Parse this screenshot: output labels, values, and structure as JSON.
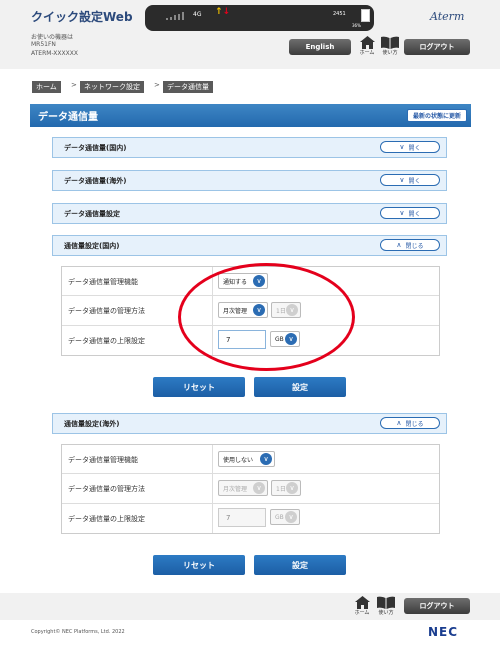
{
  "header": {
    "app_title": "クイック設定Web",
    "device_label": "お使いの機器は",
    "model": "MR51FN",
    "serial": "ATERM-XXXXXX",
    "brand": "Aterm",
    "status": {
      "network": "4G",
      "time": "2451",
      "battery": "36%"
    },
    "english_label": "English",
    "home_label": "ホーム",
    "manual_label": "使い方",
    "logout_label": "ログアウト"
  },
  "breadcrumb": [
    "ホーム",
    "ネットワーク設定",
    "データ通信量"
  ],
  "page": {
    "title": "データ通信量",
    "refresh_label": "最新の状態に更新"
  },
  "accordions": [
    {
      "label": "データ通信量(国内)",
      "button": "開く"
    },
    {
      "label": "データ通信量(海外)",
      "button": "開く"
    },
    {
      "label": "データ通信量設定",
      "button": "開く"
    },
    {
      "label": "通信量設定(国内)",
      "button": "閉じる"
    },
    {
      "label": "通信量設定(海外)",
      "button": "閉じる"
    }
  ],
  "domestic": {
    "rows": [
      {
        "label": "データ通信量管理機能",
        "value": "通知する"
      },
      {
        "label": "データ通信量の管理方法",
        "value": "月次管理",
        "day": "1日"
      },
      {
        "label": "データ通信量の上限設定",
        "value": "7",
        "unit": "GB"
      }
    ]
  },
  "overseas": {
    "rows": [
      {
        "label": "データ通信量管理機能",
        "value": "使用しない"
      },
      {
        "label": "データ通信量の管理方法",
        "value": "月次管理",
        "day": "1日"
      },
      {
        "label": "データ通信量の上限設定",
        "value": "7",
        "unit": "GB"
      }
    ]
  },
  "buttons": {
    "reset": "リセット",
    "apply": "設定"
  },
  "footer": {
    "copyright": "Copyright© NEC Platforms, Ltd. 2022",
    "logo": "NEC"
  }
}
